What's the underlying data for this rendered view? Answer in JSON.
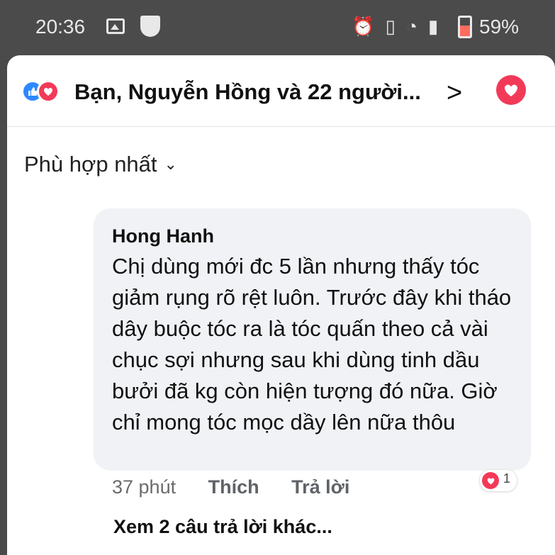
{
  "status_bar": {
    "time": "20:36",
    "battery": "59%"
  },
  "header": {
    "reaction_summary": "Bạn, Nguyễn Hồng và 22 người..."
  },
  "sort": {
    "label": "Phù hợp nhất"
  },
  "comment": {
    "author": "Hong Hanh",
    "text": "Chị dùng mới đc 5 lần nhưng thấy tóc giảm rụng rõ rệt luôn. Trước đây khi tháo dây buộc tóc ra là tóc quấn theo cả vài chục sợi nhưng sau khi dùng tinh dầu bưởi đã kg còn hiện tượng đó nữa. Giờ chỉ mong tóc mọc dầy lên nữa thôu",
    "time": "37 phút",
    "like_label": "Thích",
    "reply_label": "Trả lời",
    "reaction_count": "1"
  },
  "more_replies_label": "Xem 2 câu trả lời khác...",
  "colors": {
    "like_blue": "#2d88ff",
    "love_red": "#f23a58",
    "bubble_gray": "#f0f2f5"
  },
  "icons": {
    "like": "thumbs-up-icon",
    "love": "heart-icon"
  }
}
